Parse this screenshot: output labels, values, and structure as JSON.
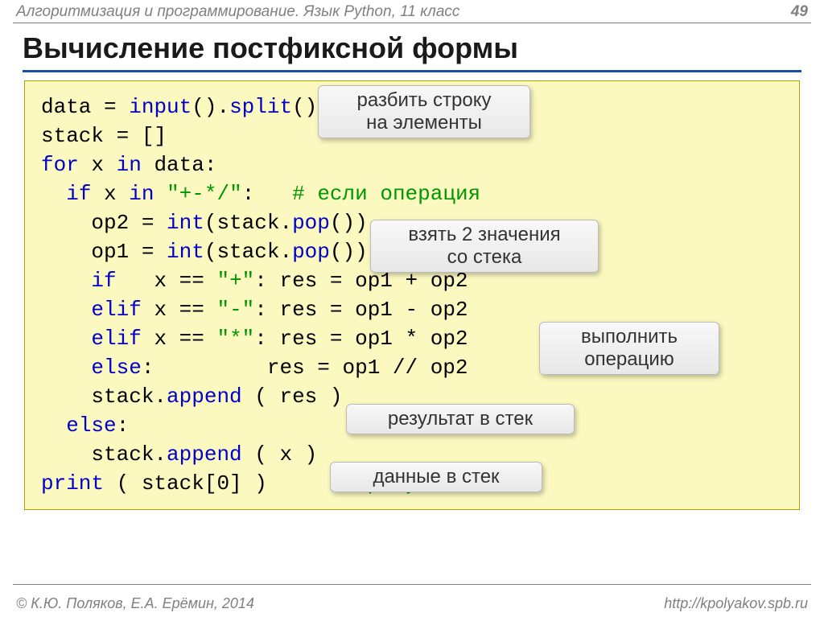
{
  "header": {
    "left": "Алгоритмизация и программирование. Язык Python, 11 класс",
    "page": "49"
  },
  "title": "Вычисление постфиксной формы",
  "code": {
    "l1a": "data",
    "l1b": " = ",
    "l1c": "input",
    "l1d": "().",
    "l1e": "split",
    "l1f": "()",
    "l2": "stack = []",
    "l3a": "for",
    "l3b": " x ",
    "l3c": "in",
    "l3d": " data:",
    "l4a": "  ",
    "l4b": "if",
    "l4c": " x ",
    "l4d": "in",
    "l4e": " ",
    "l4f": "\"+-*/\"",
    "l4g": ":   ",
    "l4h": "# если операция",
    "l5a": "    op2 = ",
    "l5b": "int",
    "l5c": "(stack.",
    "l5d": "pop",
    "l5e": "())",
    "l6a": "    op1 = ",
    "l6b": "int",
    "l6c": "(stack.",
    "l6d": "pop",
    "l6e": "())",
    "l7a": "    ",
    "l7b": "if",
    "l7c": "   x == ",
    "l7d": "\"+\"",
    "l7e": ": res = op1 + op2",
    "l8a": "    ",
    "l8b": "elif",
    "l8c": " x == ",
    "l8d": "\"-\"",
    "l8e": ": res = op1 - op2",
    "l9a": "    ",
    "l9b": "elif",
    "l9c": " x == ",
    "l9d": "\"*\"",
    "l9e": ": res = op1 * op2",
    "l10a": "    ",
    "l10b": "else",
    "l10c": ":         res = op1 // op2",
    "l11a": "    stack.",
    "l11b": "append",
    "l11c": " ( res )",
    "l12a": "  ",
    "l12b": "else",
    "l12c": ":",
    "l13a": "    stack.",
    "l13b": "append",
    "l13c": " ( x )",
    "l14a": "print",
    "l14b": " ( stack[0] )      ",
    "l14c": "# результат"
  },
  "callouts": {
    "c1": "разбить строку\nна элементы",
    "c2": "взять 2 значения\nсо стека",
    "c3": "выполнить\nоперацию",
    "c4": "результат в стек",
    "c5": "данные в стек"
  },
  "footer": {
    "left": "© К.Ю. Поляков, Е.А. Ерёмин, 2014",
    "right": "http://kpolyakov.spb.ru"
  }
}
